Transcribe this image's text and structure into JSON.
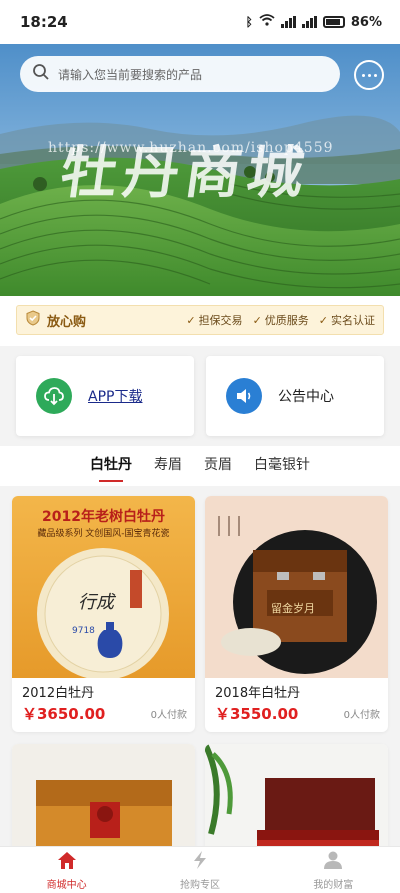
{
  "status": {
    "time": "18:24",
    "battery": "86%"
  },
  "banner": {
    "search_placeholder": "请输入您当前要搜索的产品",
    "watermark": "https://www.huzhan.com/ishop4559",
    "title": "牡丹商城"
  },
  "trust": {
    "main": "放心购",
    "features": [
      "担保交易",
      "优质服务",
      "实名认证"
    ]
  },
  "quick_links": {
    "app": "APP下载",
    "notice": "公告中心"
  },
  "tabs": [
    "白牡丹",
    "寿眉",
    "贡眉",
    "白毫银针"
  ],
  "products": [
    {
      "name": "2012白牡丹",
      "price": "￥3650.00",
      "sold": "0人付款",
      "img_title": "2012年老树白牡丹",
      "img_sub": "藏品级系列 文创国风-国宝青花瓷",
      "img_brand": "9718"
    },
    {
      "name": "2018年白牡丹",
      "price": "￥3550.00",
      "sold": "0人付款",
      "img_title": "留金岁月"
    },
    {
      "name": "",
      "price": "",
      "sold": ""
    },
    {
      "name": "",
      "price": "",
      "sold": ""
    }
  ],
  "nav": [
    "商城中心",
    "抢购专区",
    "我的财富"
  ],
  "colors": {
    "accent": "#d02a2a",
    "price": "#e02020",
    "trust_bg": "#fdf3da"
  }
}
